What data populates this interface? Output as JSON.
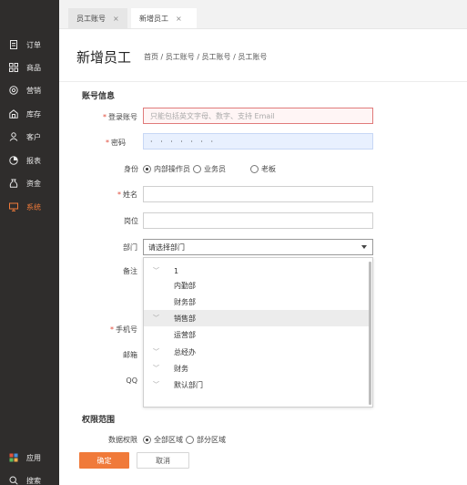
{
  "sidebar": {
    "items": [
      {
        "label": "订单",
        "icon": "order-icon"
      },
      {
        "label": "商品",
        "icon": "product-icon"
      },
      {
        "label": "营销",
        "icon": "marketing-icon"
      },
      {
        "label": "库存",
        "icon": "inventory-icon"
      },
      {
        "label": "客户",
        "icon": "customer-icon"
      },
      {
        "label": "报表",
        "icon": "report-icon"
      },
      {
        "label": "资金",
        "icon": "funds-icon"
      },
      {
        "label": "系统",
        "icon": "system-icon"
      }
    ],
    "bottom": [
      {
        "label": "应用",
        "icon": "apps-icon"
      },
      {
        "label": "搜索",
        "icon": "search-icon"
      }
    ],
    "active_color": "#f07a3a"
  },
  "tabs": [
    {
      "label": "员工账号",
      "close": "×"
    },
    {
      "label": "新增员工",
      "close": "×"
    }
  ],
  "header": {
    "title": "新增员工",
    "breadcrumb": "首页 / 员工账号 / 员工账号 / 员工账号"
  },
  "form": {
    "section_account": "账号信息",
    "login_label": "登录账号",
    "login_placeholder": "只能包括英文字母、数字、支持 Email",
    "password_label": "密码",
    "password_value": "· · · · · · ·",
    "identity_label": "身份",
    "identity_options": [
      "内部操作员",
      "业务员",
      "老板"
    ],
    "identity_selected": "内部操作员",
    "name_label": "姓名",
    "position_label": "岗位",
    "dept_label": "部门",
    "dept_placeholder": "请选择部门",
    "remark_label": "备注",
    "phone_label": "手机号",
    "email_label": "邮箱",
    "qq_label": "QQ",
    "required_mark": "*",
    "dept_options": [
      {
        "label": "1",
        "has_children": true
      },
      {
        "label": "内勤部",
        "has_children": false
      },
      {
        "label": "财务部",
        "has_children": false
      },
      {
        "label": "销售部",
        "has_children": true,
        "highlighted": true
      },
      {
        "label": "运营部",
        "has_children": false
      },
      {
        "label": "总经办",
        "has_children": true
      },
      {
        "label": "财务",
        "has_children": true
      },
      {
        "label": "默认部门",
        "has_children": true
      }
    ],
    "section_scope": "权限范围",
    "data_perm_label": "数据权限",
    "data_perm_options": [
      "全部区域",
      "部分区域"
    ],
    "data_perm_selected": "全部区域"
  },
  "buttons": {
    "confirm": "确定",
    "cancel": "取消"
  },
  "colors": {
    "accent": "#f07a3a",
    "error_border": "#e07a7a",
    "sidebar_bg": "#2f2d2c"
  }
}
